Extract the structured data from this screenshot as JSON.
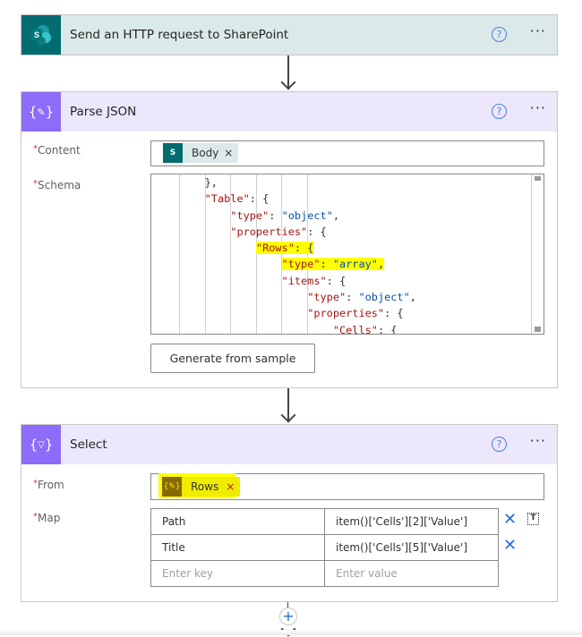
{
  "actions": [
    {
      "title": "Send an HTTP request to SharePoint",
      "icon": "sharepoint-icon",
      "color": "#036c70",
      "header_bg": "#dbe9e9"
    },
    {
      "title": "Parse JSON",
      "icon": "parse-json-icon",
      "color": "#8c6cf8",
      "header_bg": "#ede7fc"
    },
    {
      "title": "Select",
      "icon": "select-icon",
      "color": "#8c6cf8",
      "header_bg": "#ede7fc"
    }
  ],
  "parse_json": {
    "content_label": "Content",
    "content_token": "Body",
    "schema_label": "Schema",
    "schema_lines": [
      "    },",
      "    \"Table\": {",
      "        \"type\": \"object\",",
      "        \"properties\": {",
      "            \"Rows\": {",
      "                \"type\": \"array\",",
      "                \"items\": {",
      "                    \"type\": \"object\",",
      "                    \"properties\": {",
      "                        \"Cells\": {"
    ],
    "highlighted_lines": [
      4,
      5
    ],
    "generate_button": "Generate from sample"
  },
  "select": {
    "from_label": "From",
    "from_token": "Rows",
    "map_label": "Map",
    "map_rows": [
      {
        "key": "Path",
        "value": "item()['Cells'][2]['Value']"
      },
      {
        "key": "Title",
        "value": "item()['Cells'][5]['Value']"
      }
    ],
    "key_placeholder": "Enter key",
    "value_placeholder": "Enter value"
  },
  "required_marker": "*",
  "colors": {
    "accent": "#2b6bd6",
    "highlight": "#ffff00"
  }
}
